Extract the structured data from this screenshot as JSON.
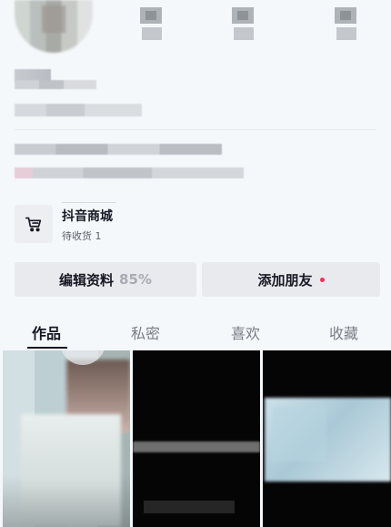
{
  "profile": {
    "avatar_label": "",
    "stats": [
      {
        "value": "",
        "label": ""
      },
      {
        "value": "",
        "label": ""
      },
      {
        "value": "",
        "label": ""
      }
    ]
  },
  "shop": {
    "title": "抖音商城",
    "subtitle": "待收货 1",
    "icon": "cart-icon"
  },
  "actions": {
    "edit_profile_label": "编辑资料",
    "edit_profile_progress": "85%",
    "add_friend_label": "添加朋友",
    "add_friend_dot_color": "#fe2c55"
  },
  "tabs": [
    {
      "label": "作品",
      "active": true
    },
    {
      "label": "私密",
      "active": false
    },
    {
      "label": "喜欢",
      "active": false
    },
    {
      "label": "收藏",
      "active": false
    }
  ],
  "colors": {
    "background": "#f5f8fb",
    "text_primary": "#161823",
    "accent": "#fe2c55",
    "button_bg": "#e9eaee"
  }
}
